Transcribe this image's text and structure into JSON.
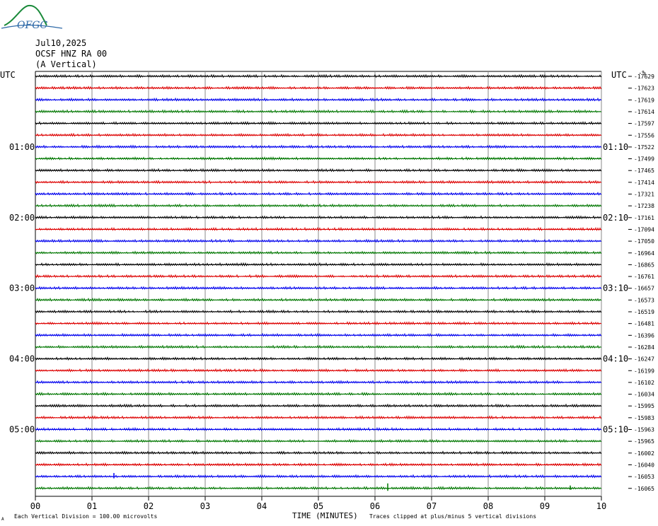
{
  "logo": {
    "text": "OFGC",
    "color": "#2f6aa8",
    "accent": "#1a8a3a"
  },
  "header": {
    "date": "Jul10,2025",
    "station": "OCSF HNZ RA 00",
    "component": "(A Vertical)"
  },
  "chart_data": {
    "type": "line",
    "x": [
      "00",
      "01",
      "02",
      "03",
      "04",
      "05",
      "06",
      "07",
      "08",
      "09",
      "10"
    ],
    "xlabel": "TIME (MINUTES)",
    "left_axis_label": "UTC",
    "right_axis_label": "UTC",
    "right_top_label": "-%",
    "left_times": [
      "01:00",
      "02:00",
      "03:00",
      "04:00",
      "05:00"
    ],
    "right_times": [
      "01:10",
      "02:10",
      "03:10",
      "04:10",
      "05:10"
    ],
    "time_label_rows": [
      6,
      12,
      18,
      24,
      30
    ],
    "trace_colors": [
      "#000000",
      "#dd0000",
      "#0000ee",
      "#007700"
    ],
    "series": [
      {
        "offset": -17629
      },
      {
        "offset": -17623
      },
      {
        "offset": -17619
      },
      {
        "offset": -17614
      },
      {
        "offset": -17597
      },
      {
        "offset": -17556
      },
      {
        "offset": -17522
      },
      {
        "offset": -17499
      },
      {
        "offset": -17465
      },
      {
        "offset": -17414
      },
      {
        "offset": -17321
      },
      {
        "offset": -17238
      },
      {
        "offset": -17161
      },
      {
        "offset": -17094
      },
      {
        "offset": -17050
      },
      {
        "offset": -16964
      },
      {
        "offset": -16865
      },
      {
        "offset": -16761
      },
      {
        "offset": -16657
      },
      {
        "offset": -16573
      },
      {
        "offset": -16519
      },
      {
        "offset": -16481
      },
      {
        "offset": -16396
      },
      {
        "offset": -16284
      },
      {
        "offset": -16247
      },
      {
        "offset": -16199
      },
      {
        "offset": -16102
      },
      {
        "offset": -16034
      },
      {
        "offset": -15995
      },
      {
        "offset": -15983
      },
      {
        "offset": -15963
      },
      {
        "offset": -15965
      },
      {
        "offset": -16002
      },
      {
        "offset": -16040
      },
      {
        "offset": -16053
      },
      {
        "offset": -16065
      }
    ],
    "footer_left": "Each Vertical Division =  100.00 microvolts",
    "footer_right": "Traces clipped at plus/minus 5 vertical divisions",
    "footer_mark": "A"
  }
}
